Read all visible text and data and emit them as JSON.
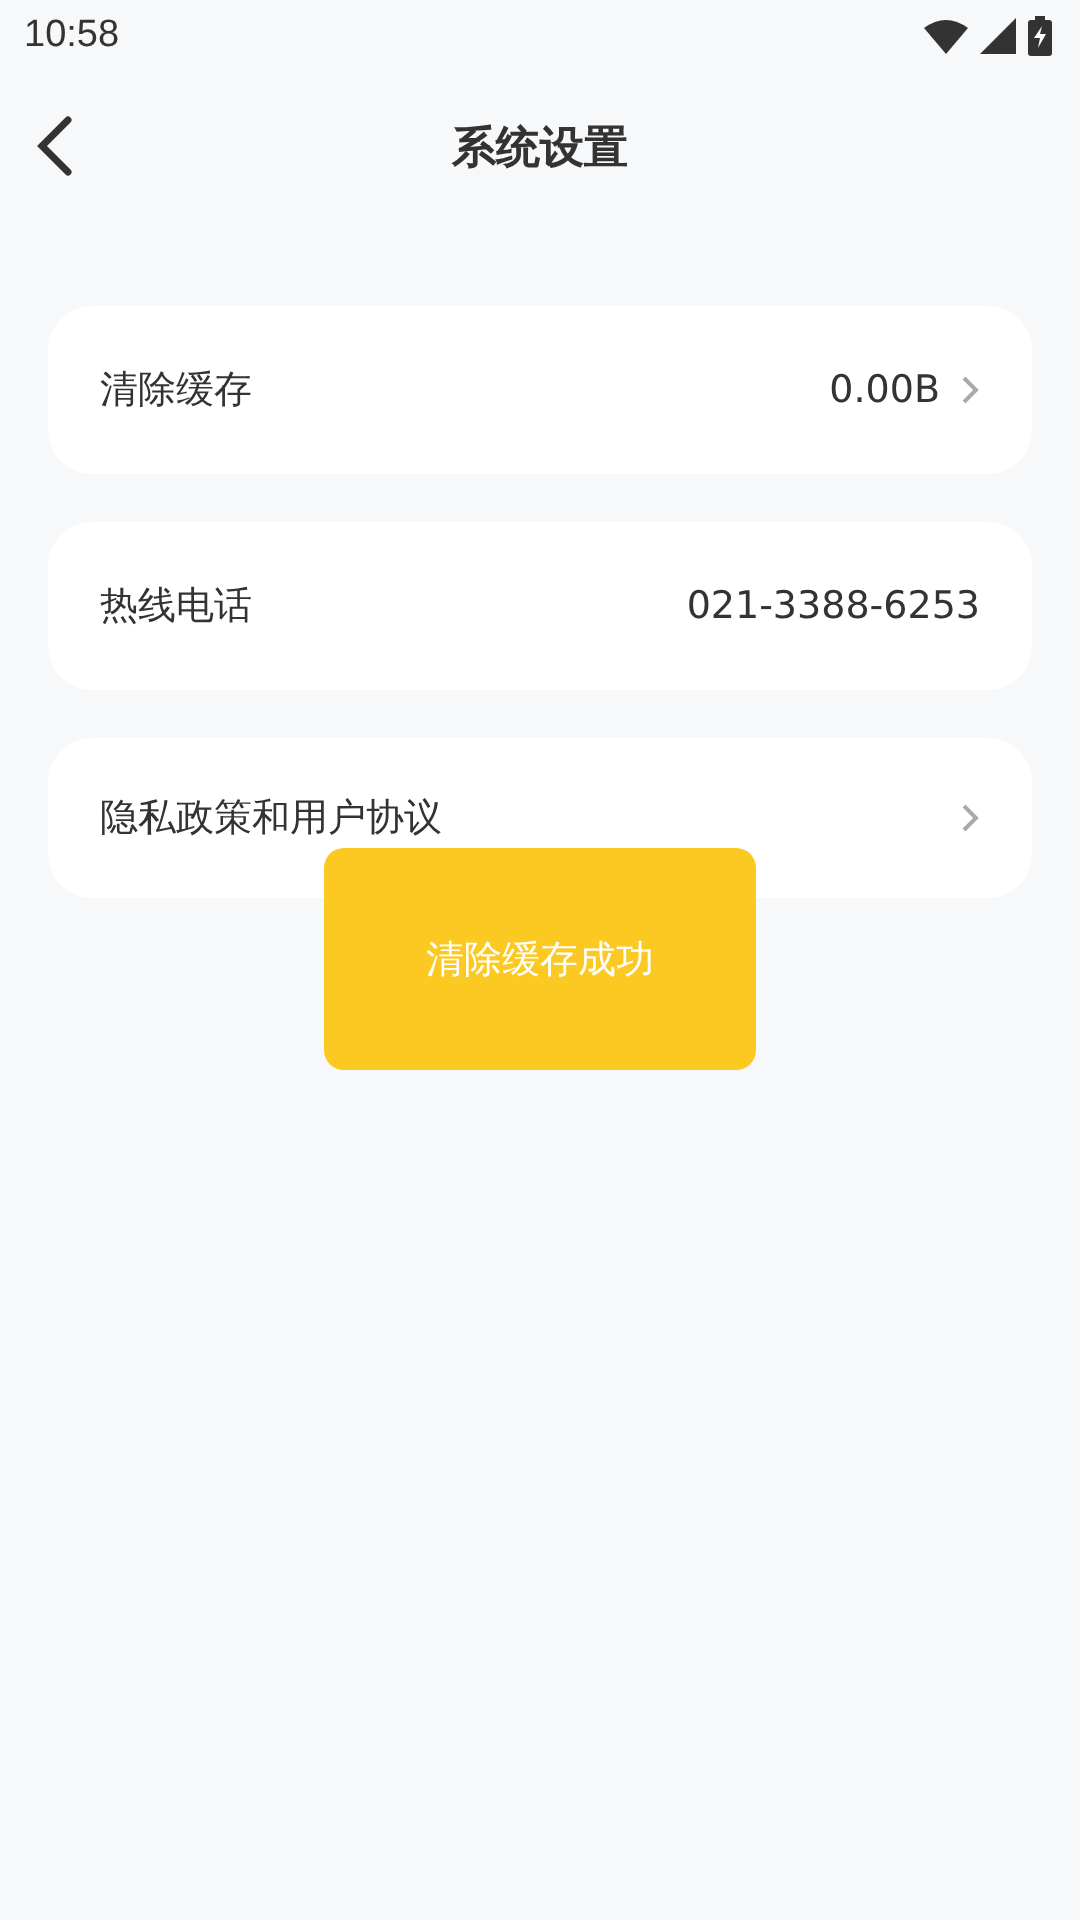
{
  "status_bar": {
    "time": "10:58"
  },
  "header": {
    "title": "系统设置"
  },
  "settings": [
    {
      "label": "清除缓存",
      "value": "0.00B",
      "kind": "link"
    },
    {
      "label": "热线电话",
      "value": "021-3388-6253",
      "kind": "info"
    },
    {
      "label": "隐私政策和用户协议",
      "kind": "link"
    }
  ],
  "toast": {
    "text": "清除缓存成功"
  }
}
